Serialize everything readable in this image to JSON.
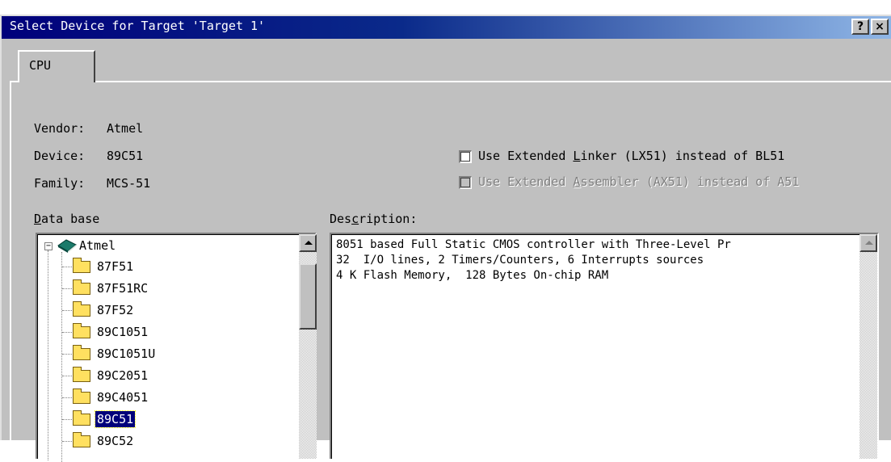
{
  "window": {
    "title": "Select Device for Target 'Target 1'",
    "help_label": "?",
    "close_label": "×"
  },
  "tabs": [
    {
      "label": "CPU",
      "active": true
    }
  ],
  "info": {
    "vendor_label": "Vendor:",
    "vendor_value": "Atmel",
    "device_label": "Device:",
    "device_value": "89C51",
    "family_label": "Family:",
    "family_value": "MCS-51"
  },
  "options": {
    "linker": {
      "pre": "Use Extended ",
      "hotkey": "L",
      "post": "inker (LX51) instead of BL51",
      "checked": false,
      "enabled": true
    },
    "assembler": {
      "pre": "Use Extended ",
      "hotkey": "A",
      "post": "ssembler (AX51) instead of A51",
      "checked": false,
      "enabled": false
    }
  },
  "database": {
    "label_hotkey": "D",
    "label_rest": "ata base",
    "root": {
      "label": "Atmel",
      "expander": "−"
    },
    "items": [
      "87F51",
      "87F51RC",
      "87F52",
      "89C1051",
      "89C1051U",
      "89C2051",
      "89C4051",
      "89C51",
      "89C52"
    ],
    "selected": "89C51"
  },
  "description": {
    "label_pre": "Des",
    "label_hotkey": "c",
    "label_post": "ription:",
    "lines": [
      "8051 based Full Static CMOS controller with Three-Level Pr",
      "32  I/O lines, 2 Timers/Counters, 6 Interrupts sources",
      "4 K Flash Memory,  128 Bytes On-chip RAM"
    ]
  },
  "colors": {
    "titlebar_start": "#00007b",
    "titlebar_end": "#8fb6e6",
    "face": "#c0c0c0",
    "selection": "#00007b",
    "folder": "#ffe060"
  }
}
